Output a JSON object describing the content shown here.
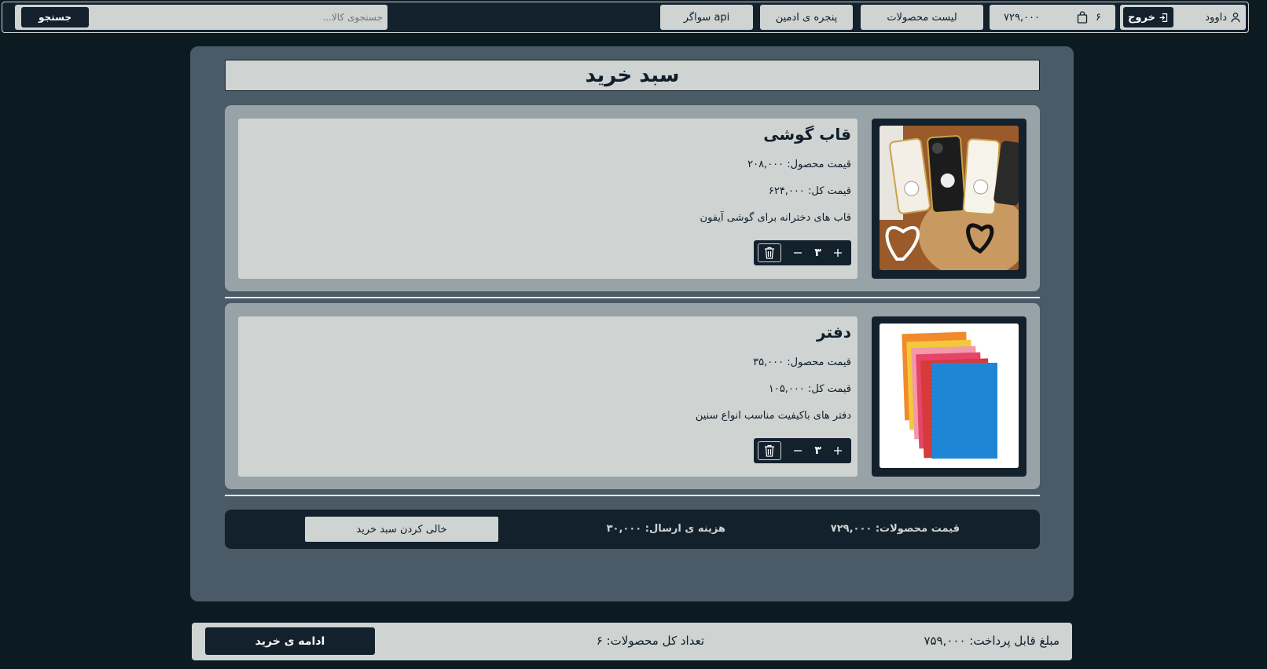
{
  "navbar": {
    "user_name": "داوود",
    "logout_label": "خروج",
    "cart_total": "۷۲۹,۰۰۰",
    "cart_count": "۶",
    "menu": [
      "لیست محصولات",
      "پنجره ی ادمین",
      "سواگر api"
    ],
    "search_placeholder": "جستجوی کالا...",
    "search_button": "جستجو"
  },
  "cart": {
    "title": "سبد خرید",
    "items": [
      {
        "name": "قاب گوشی",
        "price": "قیمت محصول: ۲۰۸,۰۰۰",
        "total": "قیمت کل: ۶۲۴,۰۰۰",
        "description": "قاب های دخترانه برای گوشی آیفون",
        "quantity": "۳"
      },
      {
        "name": "دفتر",
        "price": "قیمت محصول: ۳۵,۰۰۰",
        "total": "قیمت کل: ۱۰۵,۰۰۰",
        "description": "دفتر های باکیفیت مناسب انواع سنین",
        "quantity": "۳"
      }
    ],
    "summary": {
      "products_price": "قیمت محصولات: ۷۲۹,۰۰۰",
      "shipping": "هزینه ی ارسال: ۳۰,۰۰۰",
      "clear_button": "خالی کردن سبد خرید"
    }
  },
  "footer": {
    "payable": "مبلغ قابل پرداخت: ۷۵۹,۰۰۰",
    "total_count": "تعداد کل محصولات: ۶",
    "continue_button": "ادامه ی خرید"
  },
  "icons": {
    "user": "user-icon",
    "logout": "logout-icon",
    "bag": "shopping-bag-icon",
    "plus": "plus-icon",
    "minus": "minus-icon",
    "trash": "trash-icon"
  },
  "colors": {
    "background": "#0c1b22",
    "navy": "#13212d",
    "panel": "#4a5a66",
    "card": "#98a3a8",
    "light": "#cfd3d2"
  }
}
